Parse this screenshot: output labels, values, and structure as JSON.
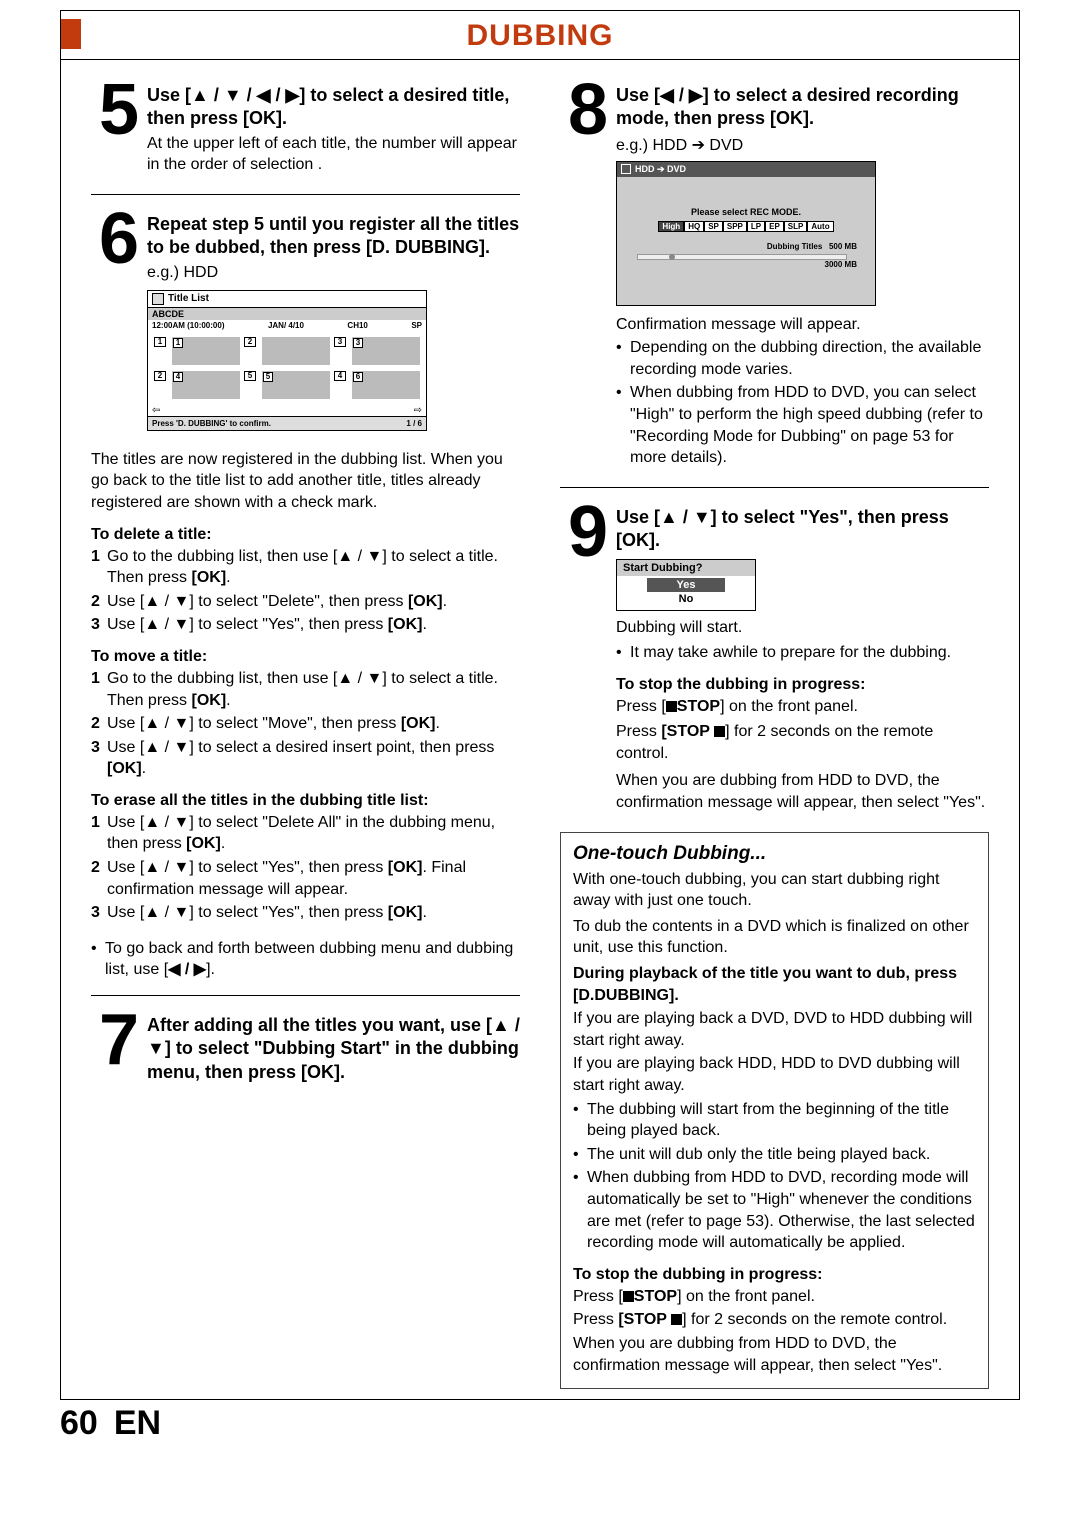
{
  "header": {
    "title": "DUBBING"
  },
  "footer": {
    "page": "60",
    "lang": "EN"
  },
  "step5": {
    "num": "5",
    "heading_pre": "Use [",
    "heading_post": "] to select a desired title, then press [OK].",
    "arrows": "▲ / ▼ / ◀ / ▶",
    "sub": "At the upper left of each title, the number will appear in the order of selection ."
  },
  "step6": {
    "num": "6",
    "heading": "Repeat step 5 until you register all the titles to be dubbed, then press [D. DUBBING].",
    "eg": "e.g.) HDD",
    "mock": {
      "title": "Title List",
      "abc": "ABCDE",
      "time": "12:00AM (10:00:00)",
      "date": "JAN/  4/10",
      "ch": "CH10",
      "mode": "SP",
      "tags": [
        "1",
        "1",
        "2",
        "3",
        "3",
        "2",
        "4",
        "5",
        "5",
        "4",
        "6"
      ],
      "foot_msg": "Press 'D. DUBBING' to confirm.",
      "foot_page": "1 / 6",
      "left_arrow": "⇦",
      "right_arrow": "⇨"
    },
    "para": "The titles are now registered in the dubbing list. When you go back to the title list to add another title, titles already registered are shown with a check mark.",
    "delete_title": "To delete a title:",
    "delete_items": [
      {
        "n": "1",
        "pre": "Go to the dubbing list, then use [",
        "arr": "▲ / ▼",
        "post": "] to select a title. Then press ",
        "ok": "[OK]",
        "tail": "."
      },
      {
        "n": "2",
        "pre": "Use [",
        "arr": "▲ / ▼",
        "post": "] to select \"Delete\", then press ",
        "ok": "[OK]",
        "tail": "."
      },
      {
        "n": "3",
        "pre": "Use [",
        "arr": "▲ / ▼",
        "post": "] to select \"Yes\", then press ",
        "ok": "[OK]",
        "tail": "."
      }
    ],
    "move_title": "To move a title:",
    "move_items": [
      {
        "n": "1",
        "pre": "Go to the dubbing list, then use [",
        "arr": "▲ / ▼",
        "post": "] to select a title. Then press ",
        "ok": "[OK]",
        "tail": "."
      },
      {
        "n": "2",
        "pre": "Use [",
        "arr": "▲ / ▼",
        "post": "] to select \"Move\", then press ",
        "ok": "[OK]",
        "tail": "."
      },
      {
        "n": "3",
        "pre": "Use [",
        "arr": "▲ / ▼",
        "post": "] to select a desired insert point, then press ",
        "ok": "[OK]",
        "tail": "."
      }
    ],
    "erase_title": "To erase all the titles in the dubbing title list:",
    "erase_items": [
      {
        "n": "1",
        "pre": "Use [",
        "arr": "▲ / ▼",
        "post": "] to select \"Delete All\" in the dubbing menu, then press ",
        "ok": "[OK]",
        "tail": "."
      },
      {
        "n": "2",
        "pre": "Use [",
        "arr": "▲ / ▼",
        "post": "] to select \"Yes\", then press ",
        "ok": "[OK]",
        "tail": ". Final confirmation message will appear."
      },
      {
        "n": "3",
        "pre": "Use [",
        "arr": "▲ / ▼",
        "post": "] to select \"Yes\", then press ",
        "ok": "[OK]",
        "tail": "."
      }
    ],
    "goback_pre": "To go back and forth between dubbing menu and dubbing list, use [",
    "goback_arr": "◀ / ▶",
    "goback_post": "]."
  },
  "step7": {
    "num": "7",
    "heading_pre": "After adding all the titles you want, use [",
    "arrows": "▲ / ▼",
    "heading_post": "] to select \"Dubbing Start\" in the dubbing menu, then press [OK]."
  },
  "step8": {
    "num": "8",
    "heading_pre": "Use [",
    "arrows": "◀ / ▶",
    "heading_post": "] to select a desired recording mode, then press [OK].",
    "eg": "e.g.) HDD ➔ DVD",
    "mock": {
      "hdr": "HDD ➔ DVD",
      "msg": "Please select REC MODE.",
      "modes": [
        "High",
        "HQ",
        "SP",
        "SPP",
        "LP",
        "EP",
        "SLP",
        "Auto"
      ],
      "selected": "High",
      "stat_lbl": "Dubbing Titles",
      "stat1": "500 MB",
      "stat2": "3000 MB"
    },
    "confirm": "Confirmation message will appear.",
    "bullets": [
      "Depending on the dubbing direction, the available recording mode varies.",
      "When dubbing from HDD to DVD, you can select \"High\" to perform the high speed dubbing (refer to \"Recording Mode for Dubbing\" on page 53 for more details)."
    ]
  },
  "step9": {
    "num": "9",
    "heading_pre": "Use [",
    "arrows": "▲ / ▼",
    "heading_post": "] to select \"Yes\", then press [OK].",
    "mock": {
      "q": "Start Dubbing?",
      "yes": "Yes",
      "no": "No"
    },
    "start": "Dubbing will start.",
    "bullet": "It may take awhile to prepare for the dubbing.",
    "stop_hdr": "To stop the dubbing in progress:",
    "stop1_pre": "Press [",
    "stop1_lbl": "STOP",
    "stop1_post": "] on the front panel.",
    "stop2_pre": "Press ",
    "stop2_lbl": "[STOP ",
    "stop2_post": "] for 2 seconds on the remote control.",
    "para": "When you are dubbing from HDD to DVD, the confirmation message will appear, then select \"Yes\"."
  },
  "onetouch": {
    "title": "One-touch Dubbing...",
    "p1": "With one-touch dubbing, you can start dubbing right away with just one touch.",
    "p2": "To dub the contents in a DVD which is finalized on other unit, use this function.",
    "during": "During playback of the title you want to dub, press [D.DUBBING].",
    "p3": "If you are playing back a DVD, DVD to HDD dubbing will start right away.",
    "p4": "If you are playing back HDD, HDD to DVD dubbing will start right away.",
    "bullets": [
      "The dubbing will start from the beginning of the title being played back.",
      "The unit will dub only the title being played back.",
      "When dubbing from HDD to DVD, recording mode will automatically be set to \"High\" whenever the conditions are met (refer to page 53). Otherwise, the last selected recording mode will automatically be applied."
    ],
    "stop_hdr": "To stop the dubbing in progress:",
    "stop1_pre": "Press [",
    "stop1_lbl": "STOP",
    "stop1_post": "] on the front panel.",
    "stop2_pre": "Press ",
    "stop2_lbl": "[STOP ",
    "stop2_post": "] for 2 seconds on the remote control.",
    "p5": "When you are dubbing from HDD to DVD, the confirmation message will appear, then select \"Yes\"."
  }
}
